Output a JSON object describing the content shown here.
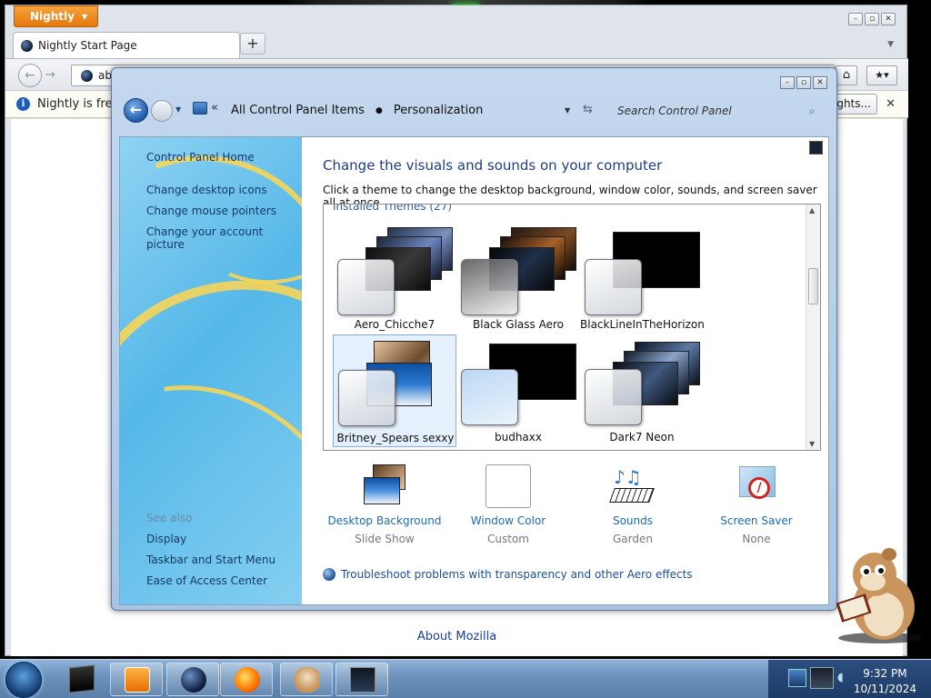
{
  "browser": {
    "app_button": "Nightly",
    "window_controls": [
      "–",
      "▫",
      "✕"
    ],
    "tab_title": "Nightly Start Page",
    "new_tab": "+",
    "url_value": "ab",
    "notification_text": "Nightly is free a",
    "notification_button": "ghts...",
    "about_link": "About Mozilla"
  },
  "control_panel": {
    "window_controls": [
      "–",
      "▫",
      "✕"
    ],
    "breadcrumb": [
      "All Control Panel Items",
      "Personalization"
    ],
    "search_placeholder": "Search Control Panel",
    "sidebar": {
      "links": [
        "Control Panel Home",
        "Change desktop icons",
        "Change mouse pointers",
        "Change your account picture"
      ],
      "see_also_label": "See also",
      "see_also": [
        "Display",
        "Taskbar and Start Menu",
        "Ease of Access Center"
      ]
    },
    "heading": "Change the visuals and sounds on your computer",
    "subheading": "Click a theme to change the desktop background, window color, sounds, and screen saver all at once.",
    "gallery_label": "Installed Themes (27)",
    "themes": [
      {
        "name": "Aero_Chicche7",
        "selected": false
      },
      {
        "name": "Black Glass Aero",
        "selected": false
      },
      {
        "name": "BlackLineInTheHorizon",
        "selected": false
      },
      {
        "name": "Britney_Spears sexxy",
        "selected": true
      },
      {
        "name": "budhaxx",
        "selected": false
      },
      {
        "name": "Dark7 Neon",
        "selected": false
      }
    ],
    "settings": [
      {
        "label": "Desktop Background",
        "value": "Slide Show"
      },
      {
        "label": "Window Color",
        "value": "Custom"
      },
      {
        "label": "Sounds",
        "value": "Garden"
      },
      {
        "label": "Screen Saver",
        "value": "None"
      }
    ],
    "troubleshoot_link": "Troubleshoot problems with transparency and other Aero effects"
  },
  "taskbar": {
    "apps": [
      "media-center-icon",
      "windows-media-player-icon",
      "nightly-icon",
      "firefox-icon",
      "hamster-icon",
      "personalization-icon"
    ],
    "clock_time": "9:32 PM",
    "clock_date": "10/11/2024"
  }
}
